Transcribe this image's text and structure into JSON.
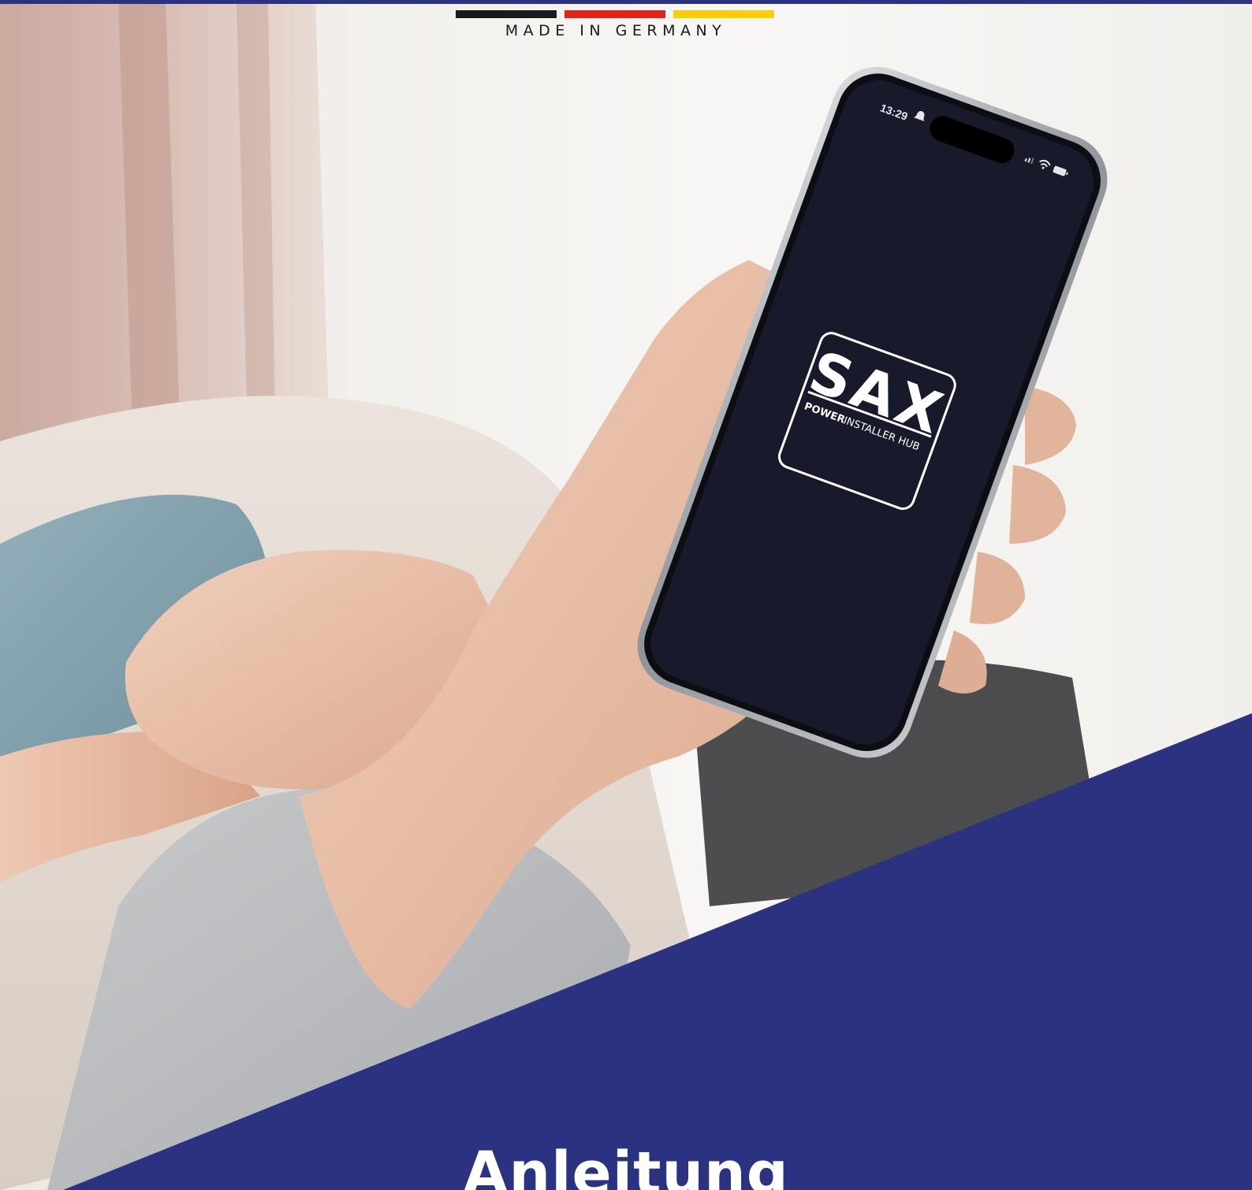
{
  "badge": {
    "text": "MADE IN GERMANY",
    "flag_colors": [
      "#1a1a1a",
      "#e2231a",
      "#f6cf08"
    ]
  },
  "phone": {
    "time": "13:29",
    "logo_wordmark": "SAX",
    "logo_line1": "POWER",
    "logo_line2": "INSTALLER HUB"
  },
  "title": "Anleitung",
  "colors": {
    "brand": "#2b3280",
    "screen": "#181a2b"
  },
  "icons": [
    "signal-icon",
    "wifi-icon",
    "battery-icon",
    "bell-icon"
  ]
}
